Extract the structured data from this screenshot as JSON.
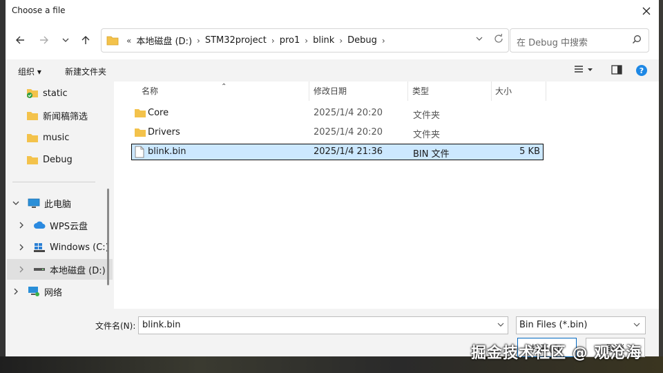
{
  "window": {
    "title": "Choose a file"
  },
  "address": {
    "crumbs": [
      "本地磁盘 (D:)",
      "STM32project",
      "pro1",
      "blink",
      "Debug"
    ],
    "overflow": "«"
  },
  "search": {
    "placeholder": "在 Debug 中搜索"
  },
  "toolbar": {
    "organize": "组织 ▾",
    "new_folder": "新建文件夹"
  },
  "sidebar": {
    "quick": [
      {
        "label": "static",
        "icon": "folder-green-check-icon"
      },
      {
        "label": "新闻稿筛选",
        "icon": "folder-icon"
      },
      {
        "label": "music",
        "icon": "folder-icon"
      },
      {
        "label": "Debug",
        "icon": "folder-icon"
      }
    ],
    "this_pc": "此电脑",
    "pc_items": [
      {
        "label": "WPS云盘",
        "icon": "cloud-icon"
      },
      {
        "label": "Windows (C:)",
        "icon": "windows-drive-icon"
      },
      {
        "label": "本地磁盘 (D:)",
        "icon": "drive-icon",
        "selected": true
      }
    ],
    "network": "网络"
  },
  "columns": {
    "name": "名称",
    "modified": "修改日期",
    "type": "类型",
    "size": "大小"
  },
  "files": [
    {
      "name": "Core",
      "modified": "2025/1/4 20:20",
      "type": "文件夹",
      "size": "",
      "icon": "folder-icon",
      "selected": false
    },
    {
      "name": "Drivers",
      "modified": "2025/1/4 20:20",
      "type": "文件夹",
      "size": "",
      "icon": "folder-icon",
      "selected": false
    },
    {
      "name": "blink.bin",
      "modified": "2025/1/4 21:36",
      "type": "BIN 文件",
      "size": "5 KB",
      "icon": "file-icon",
      "selected": true
    }
  ],
  "bottom": {
    "filename_label": "文件名(N):",
    "filename_value": "blink.bin",
    "filter_value": "Bin Files (*.bin)",
    "open_label": "打开(O)",
    "cancel_label": "取消"
  },
  "watermark": "掘金技术社区 @ 观沧海",
  "colors": {
    "folder": "#f3c24b",
    "selection": "#cce8ff",
    "accent": "#0067c0"
  }
}
